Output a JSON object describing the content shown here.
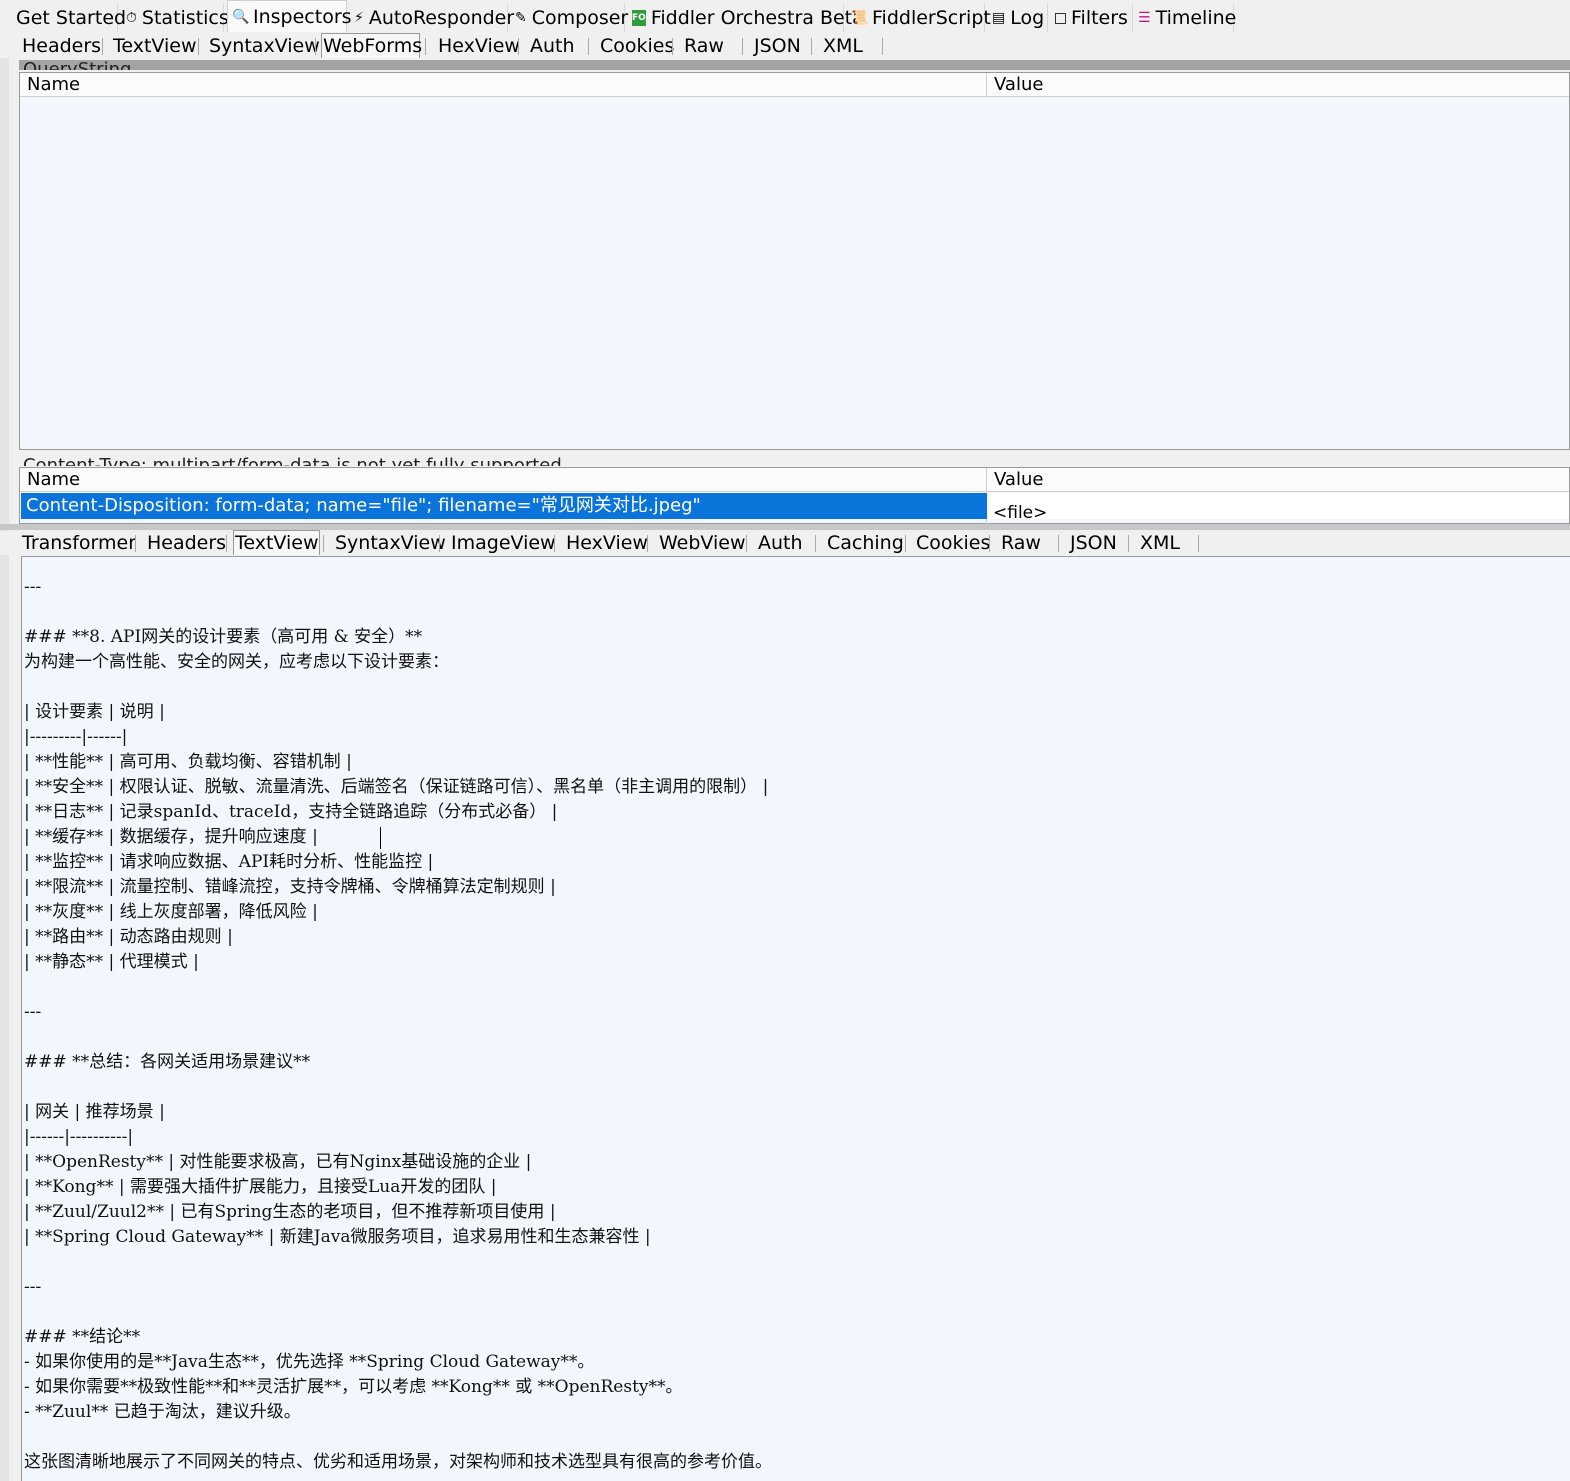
{
  "main_tabs": [
    {
      "label": "Get Started",
      "icon": ""
    },
    {
      "label": "Statistics",
      "icon": "stopwatch-icon"
    },
    {
      "label": "Inspectors",
      "icon": "magnifier-icon"
    },
    {
      "label": "AutoResponder",
      "icon": "lightning-icon"
    },
    {
      "label": "Composer",
      "icon": "edit-icon"
    },
    {
      "label": "Fiddler Orchestra Beta",
      "icon": "fo-icon"
    },
    {
      "label": "FiddlerScript",
      "icon": "script-icon"
    },
    {
      "label": "Log",
      "icon": "log-icon"
    },
    {
      "label": "Filters",
      "icon": "checkbox-icon"
    },
    {
      "label": "Timeline",
      "icon": "timeline-icon"
    }
  ],
  "request_tabs": [
    "Headers",
    "TextView",
    "SyntaxView",
    "WebForms",
    "HexView",
    "Auth",
    "Cookies",
    "Raw",
    "JSON",
    "XML"
  ],
  "querystring": {
    "title": "QueryString",
    "col_name": "Name",
    "col_value": "Value"
  },
  "body_section": {
    "title": "Content-Type: multipart/form-data is not yet fully supported",
    "col_name": "Name",
    "col_value": "Value",
    "row_name": "Content-Disposition: form-data; name=\"file\"; filename=\"常见网关对比.jpeg\"",
    "row_value": "<file>"
  },
  "response_tabs": [
    "Transformer",
    "Headers",
    "TextView",
    "SyntaxView",
    "ImageView",
    "HexView",
    "WebView",
    "Auth",
    "Caching",
    "Cookies",
    "Raw",
    "JSON",
    "XML"
  ],
  "text_lines": [
    "---",
    "",
    "### **8. API网关的设计要素（高可用 & 安全）**",
    "为构建一个高性能、安全的网关，应考虑以下设计要素：",
    "",
    "| 设计要素 | 说明 |",
    "|---------|------|",
    "| **性能** | 高可用、负载均衡、容错机制 |",
    "| **安全** | 权限认证、脱敏、流量清洗、后端签名（保证链路可信）、黑名单（非主调用的限制） |",
    "| **日志** | 记录spanId、traceId，支持全链路追踪（分布式必备） |",
    "| **缓存** | 数据缓存，提升响应速度 |",
    "| **监控** | 请求响应数据、API耗时分析、性能监控 |",
    "| **限流** | 流量控制、错峰流控，支持令牌桶、令牌桶算法定制规则 |",
    "| **灰度** | 线上灰度部署，降低风险 |",
    "| **路由** | 动态路由规则 |",
    "| **静态** | 代理模式 |",
    "",
    "---",
    "",
    "### **总结：各网关适用场景建议**",
    "",
    "| 网关 | 推荐场景 |",
    "|------|----------|",
    "| **OpenResty** | 对性能要求极高，已有Nginx基础设施的企业 |",
    "| **Kong** | 需要强大插件扩展能力，且接受Lua开发的团队 |",
    "| **Zuul/Zuul2** | 已有Spring生态的老项目，但不推荐新项目使用 |",
    "| **Spring Cloud Gateway** | 新建Java微服务项目，追求易用性和生态兼容性 |",
    "",
    "---",
    "",
    "### **结论**",
    "- 如果你使用的是**Java生态**，优先选择 **Spring Cloud Gateway**。",
    "- 如果你需要**极致性能**和**灵活扩展**，可以考虑 **Kong** 或 **OpenResty**。",
    "- **Zuul** 已趋于淘汰，建议升级。",
    "",
    "这张图清晰地展示了不同网关的特点、优劣和适用场景，对架构师和技术选型具有很高的参考价值。"
  ]
}
